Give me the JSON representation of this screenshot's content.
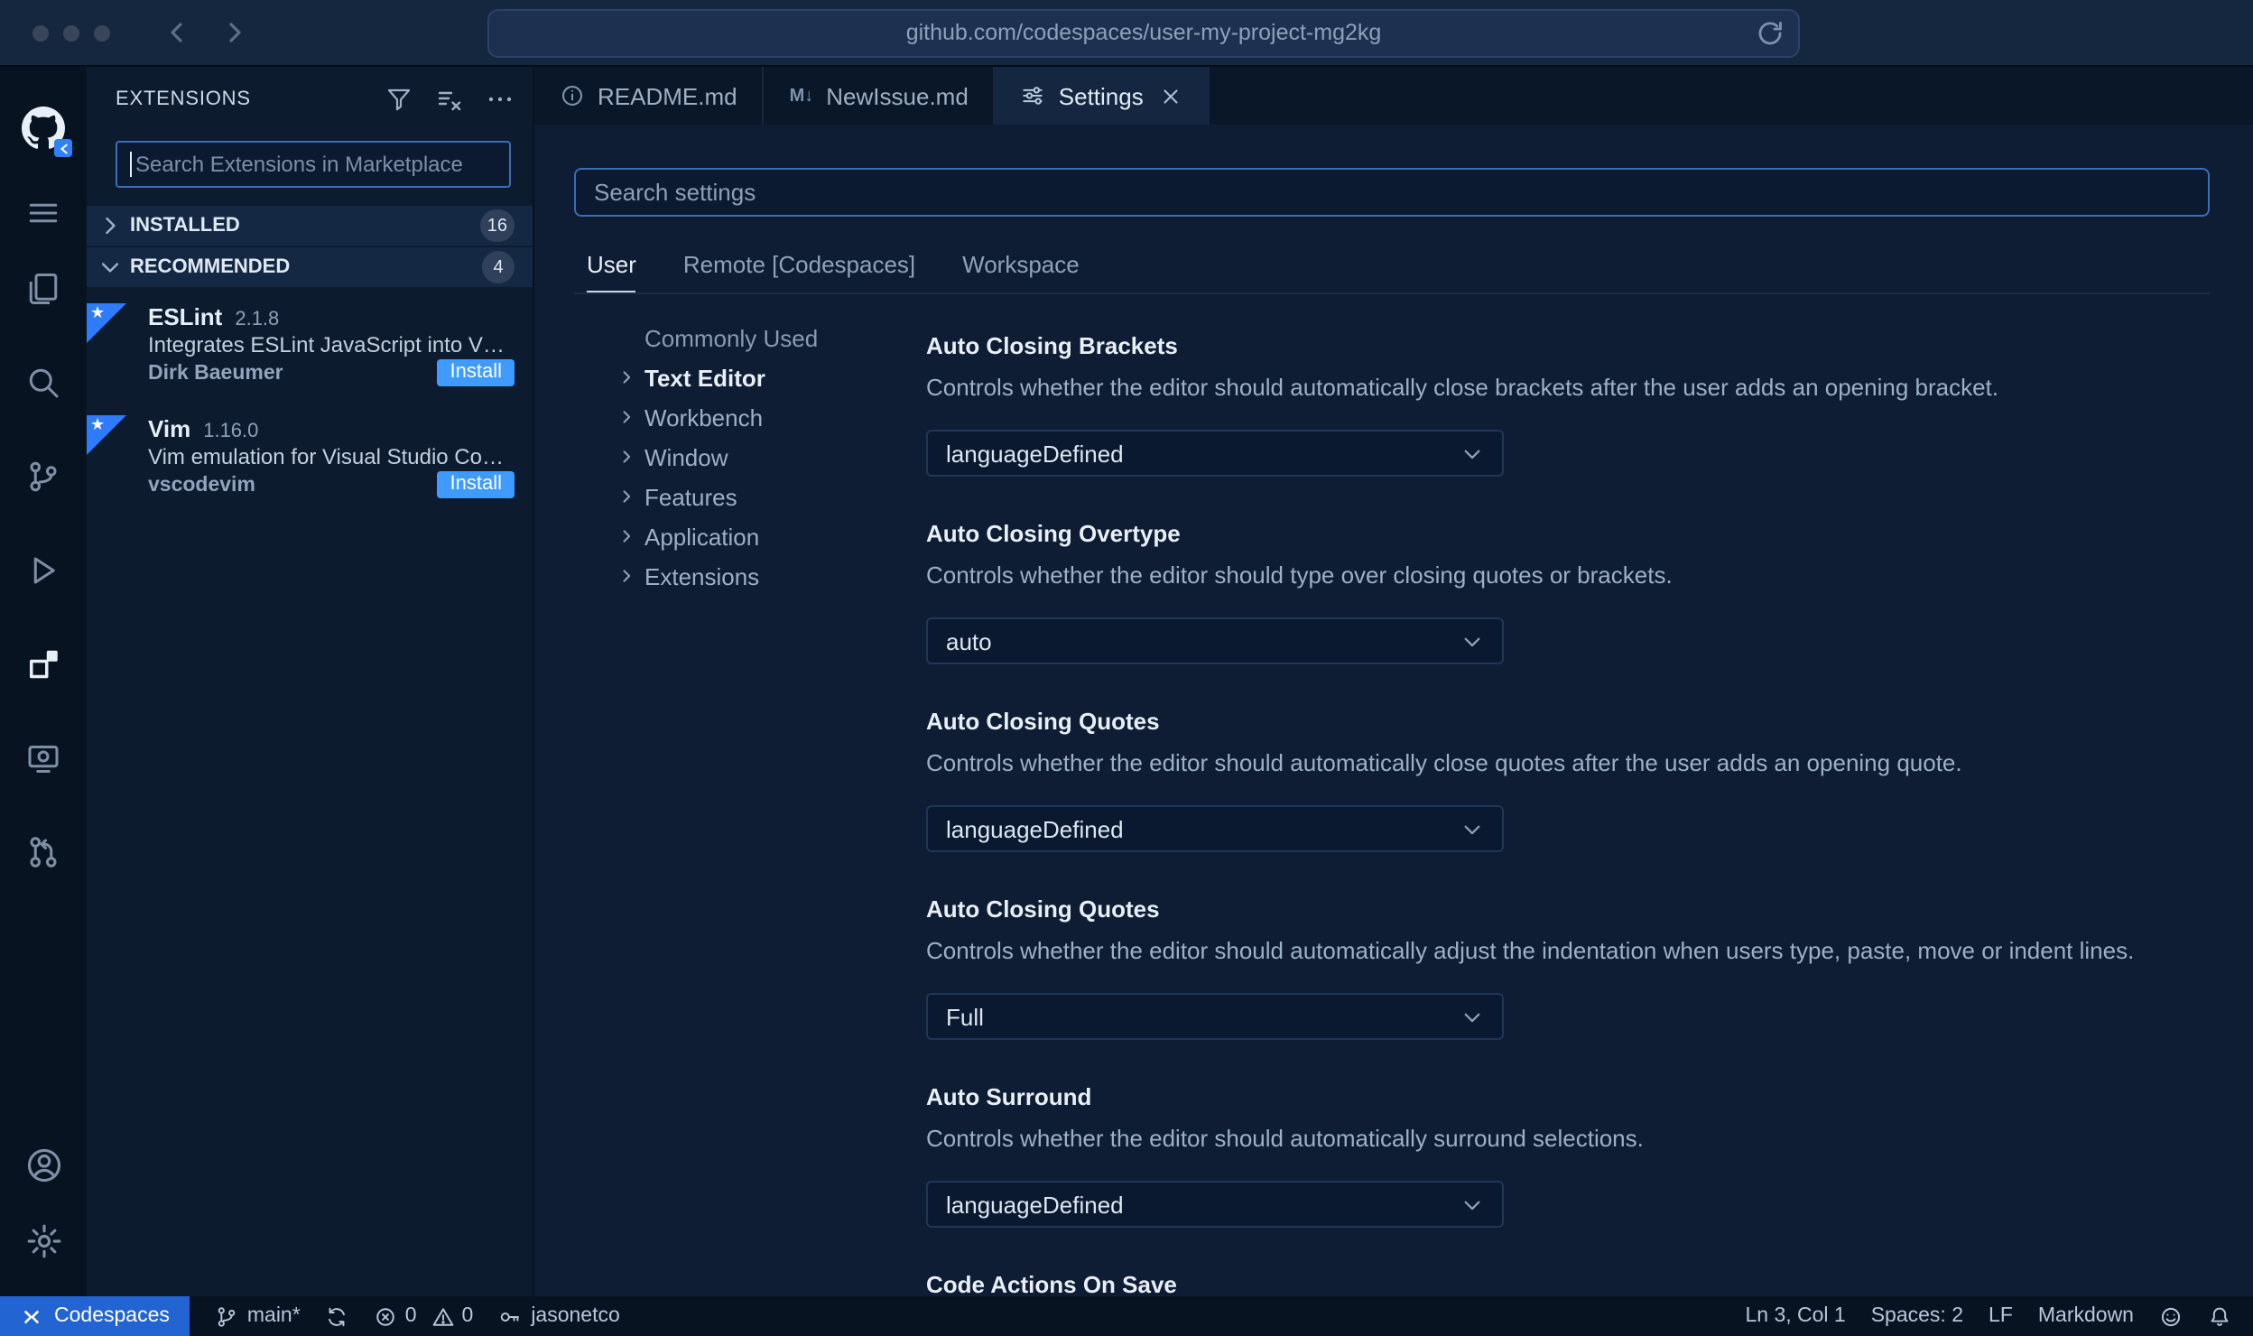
{
  "browser": {
    "url": "github.com/codespaces/user-my-project-mg2kg"
  },
  "panel": {
    "title": "EXTENSIONS",
    "search_placeholder": "Search Extensions in Marketplace",
    "sections": [
      {
        "label": "INSTALLED",
        "count": "16"
      },
      {
        "label": "RECOMMENDED",
        "count": "4"
      }
    ],
    "extensions": [
      {
        "name": "ESLint",
        "version": "2.1.8",
        "description": "Integrates ESLint JavaScript into VS C...",
        "author": "Dirk Baeumer",
        "action": "Install"
      },
      {
        "name": "Vim",
        "version": "1.16.0",
        "description": "Vim emulation for Visual Studio Code...",
        "author": "vscodevim",
        "action": "Install"
      }
    ]
  },
  "tabs": [
    {
      "label": "README.md"
    },
    {
      "label": "NewIssue.md",
      "icon_glyph": "M↓"
    },
    {
      "label": "Settings"
    }
  ],
  "settings": {
    "search_placeholder": "Search settings",
    "scopes": [
      {
        "label": "User"
      },
      {
        "label": "Remote [Codespaces]"
      },
      {
        "label": "Workspace"
      }
    ],
    "toc": [
      {
        "label": "Commonly Used"
      },
      {
        "label": "Text Editor"
      },
      {
        "label": "Workbench"
      },
      {
        "label": "Window"
      },
      {
        "label": "Features"
      },
      {
        "label": "Application"
      },
      {
        "label": "Extensions"
      }
    ],
    "items": [
      {
        "name": "Auto Closing Brackets",
        "description": "Controls whether the editor should automatically close brackets after the user adds an opening bracket.",
        "value": "languageDefined"
      },
      {
        "name": "Auto Closing Overtype",
        "description": "Controls whether the editor should type over closing quotes or brackets.",
        "value": "auto"
      },
      {
        "name": "Auto Closing Quotes",
        "description": "Controls whether the editor should automatically close quotes after the user adds an opening quote.",
        "value": "languageDefined"
      },
      {
        "name": "Auto Closing Quotes",
        "description": "Controls whether the editor should automatically adjust the indentation when users type, paste, move or indent lines.",
        "value": "Full"
      },
      {
        "name": "Auto Surround",
        "description": "Controls whether the editor should automatically surround selections.",
        "value": "languageDefined"
      },
      {
        "name": "Code Actions On Save"
      }
    ]
  },
  "status": {
    "codespaces": "Codespaces",
    "branch": "main*",
    "errors": "0",
    "warnings": "0",
    "user": "jasonetco",
    "line_col": "Ln 3, Col 1",
    "indent": "Spaces: 2",
    "eol": "LF",
    "language": "Markdown"
  },
  "colors": {
    "accent_blue": "#2265d2",
    "install_blue": "#3f9bff",
    "focus_border": "#3c6db5",
    "flag_blue": "#2e7bff"
  }
}
